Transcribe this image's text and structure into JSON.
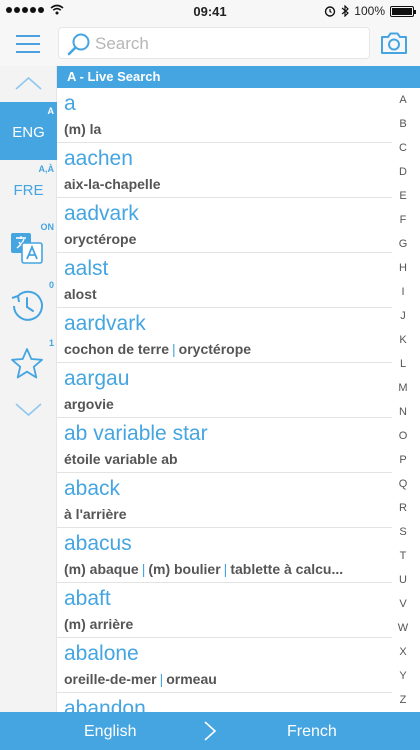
{
  "status": {
    "time": "09:41",
    "battery": "100%"
  },
  "search": {
    "placeholder": "Search"
  },
  "sidebar": {
    "source_lang": "ENG",
    "source_badge": "A",
    "target_lang": "FRE",
    "target_badge": "A,À",
    "translate_badge": "ON",
    "history_badge": "0",
    "favorites_badge": "1"
  },
  "list": {
    "section_title": "A - Live Search",
    "entries": [
      {
        "word": "a",
        "translations": [
          "(m) la"
        ]
      },
      {
        "word": "aachen",
        "translations": [
          "aix-la-chapelle"
        ]
      },
      {
        "word": "aadvark",
        "translations": [
          "oryctérope"
        ]
      },
      {
        "word": "aalst",
        "translations": [
          "alost"
        ]
      },
      {
        "word": "aardvark",
        "translations": [
          "cochon de terre",
          "oryctérope"
        ]
      },
      {
        "word": "aargau",
        "translations": [
          "argovie"
        ]
      },
      {
        "word": "ab variable star",
        "translations": [
          "étoile variable ab"
        ]
      },
      {
        "word": "aback",
        "translations": [
          "à l'arrière"
        ]
      },
      {
        "word": "abacus",
        "translations": [
          "(m) abaque",
          "(m) boulier",
          "tablette à calcu..."
        ]
      },
      {
        "word": "abaft",
        "translations": [
          "(m) arrière"
        ]
      },
      {
        "word": "abalone",
        "translations": [
          "oreille-de-mer",
          "ormeau"
        ]
      },
      {
        "word": "abandon",
        "translations": []
      }
    ]
  },
  "alphabet": [
    "A",
    "B",
    "C",
    "D",
    "E",
    "F",
    "G",
    "H",
    "I",
    "J",
    "K",
    "L",
    "M",
    "N",
    "O",
    "P",
    "Q",
    "R",
    "S",
    "T",
    "U",
    "V",
    "W",
    "X",
    "Y",
    "Z"
  ],
  "bottom": {
    "from": "English",
    "to": "French"
  },
  "colors": {
    "accent": "#45a5e1",
    "sidebar_bg": "#f3f3f3"
  }
}
